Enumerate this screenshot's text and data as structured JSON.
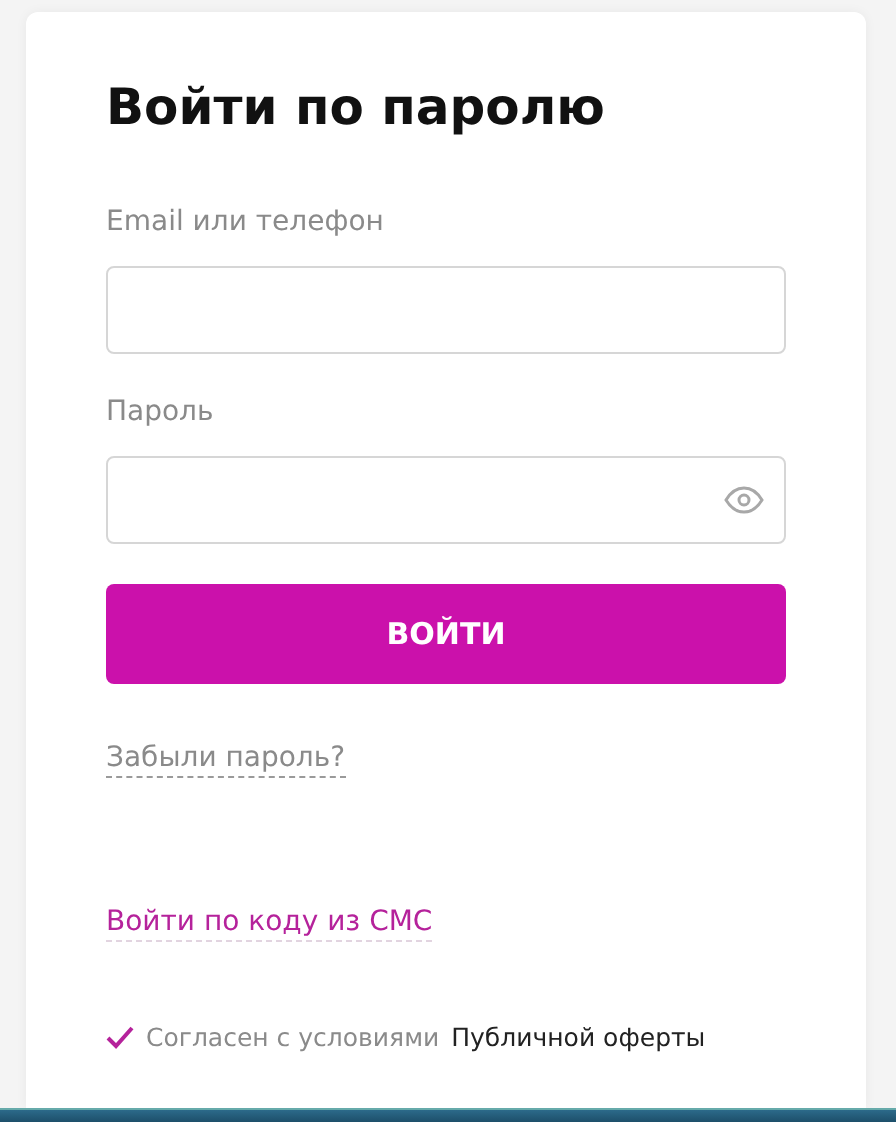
{
  "title": "Войти по паролю",
  "fields": [
    {
      "label": "Email или телефон",
      "kind": "text"
    },
    {
      "label": "Пароль",
      "kind": "password"
    }
  ],
  "submit_button": "ВОЙТИ",
  "forgot_link": "Забыли пароль?",
  "sms_link": "Войти по коду из СМС",
  "consent": {
    "checked": true,
    "text": "Согласен с условиями",
    "link": "Публичной оферты"
  }
}
